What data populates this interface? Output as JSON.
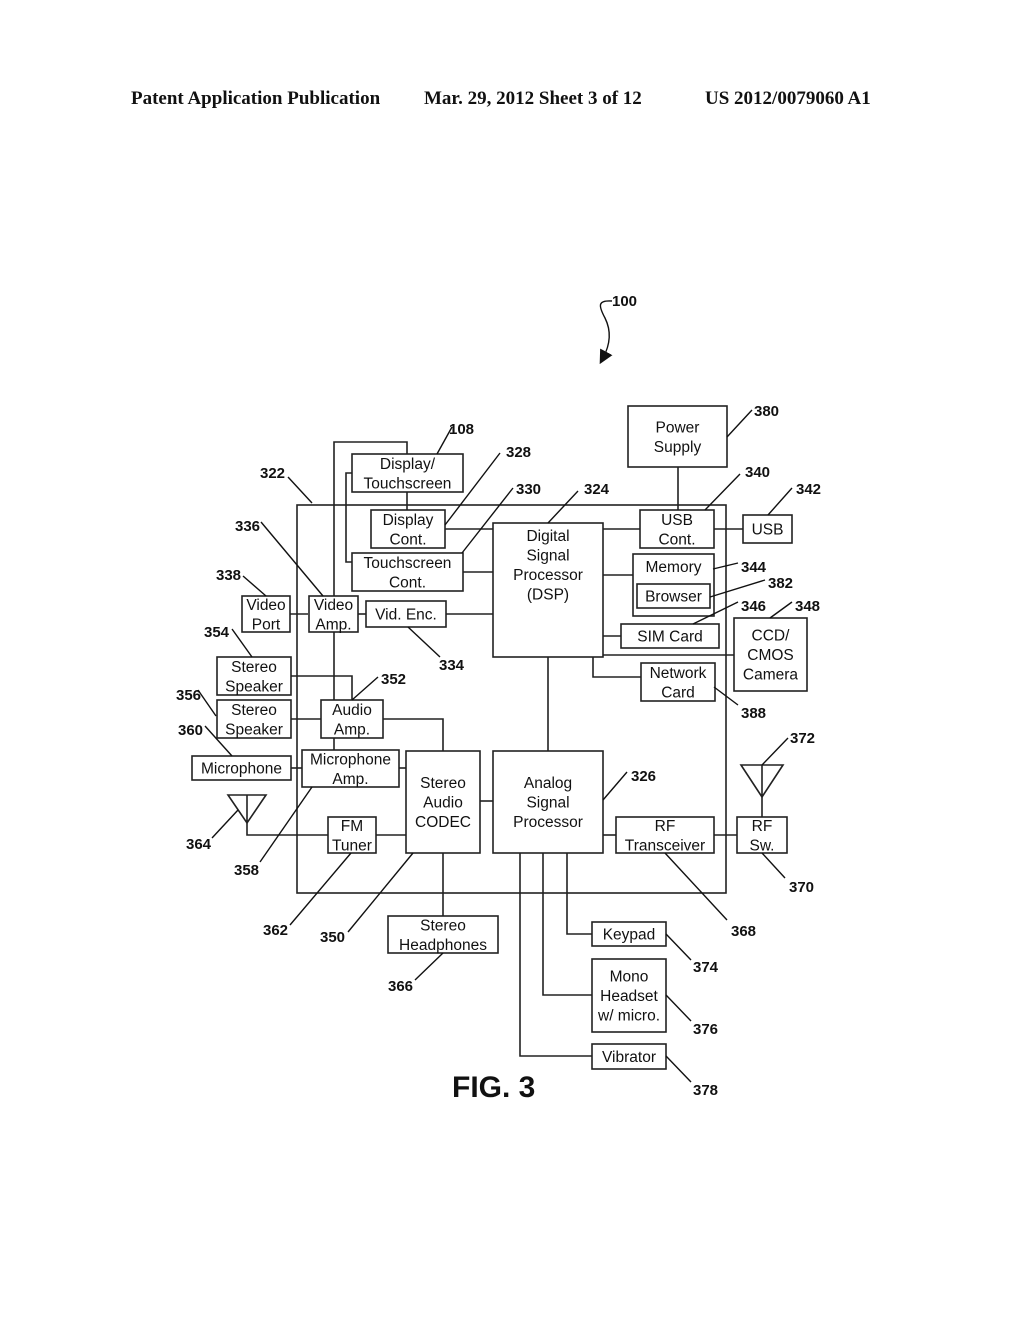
{
  "header": {
    "left": "Patent Application Publication",
    "middle": "Mar. 29, 2012  Sheet 3 of 12",
    "right": "US 2012/0079060 A1"
  },
  "figure": {
    "label": "FIG. 3",
    "device_ref": "100",
    "chip_ref": "322"
  },
  "components": [
    {
      "id": "power_supply",
      "lines": [
        "Power",
        "Supply"
      ],
      "ref": "380"
    },
    {
      "id": "display_touchscreen",
      "lines": [
        "Display/",
        "Touchscreen"
      ],
      "ref": "108"
    },
    {
      "id": "display_cont",
      "lines": [
        "Display",
        "Cont."
      ],
      "ref": "328"
    },
    {
      "id": "touchscreen_cont",
      "lines": [
        "Touchscreen",
        "Cont."
      ],
      "ref": "330"
    },
    {
      "id": "dsp",
      "lines": [
        "Digital",
        "Signal",
        "Processor",
        "(DSP)"
      ],
      "ref": "324"
    },
    {
      "id": "usb_cont",
      "lines": [
        "USB",
        "Cont."
      ],
      "ref": "340"
    },
    {
      "id": "usb",
      "lines": [
        "USB"
      ],
      "ref": "342"
    },
    {
      "id": "memory",
      "lines": [
        "Memory"
      ],
      "ref": "344"
    },
    {
      "id": "browser",
      "lines": [
        "Browser"
      ],
      "ref": "382"
    },
    {
      "id": "sim_card",
      "lines": [
        "SIM Card"
      ],
      "ref": "346"
    },
    {
      "id": "camera",
      "lines": [
        "CCD/",
        "CMOS",
        "Camera"
      ],
      "ref": "348"
    },
    {
      "id": "network_card",
      "lines": [
        "Network",
        "Card"
      ],
      "ref": "388"
    },
    {
      "id": "video_port",
      "lines": [
        "Video",
        "Port"
      ],
      "ref": "338"
    },
    {
      "id": "video_amp",
      "lines": [
        "Video",
        "Amp."
      ],
      "ref": "336"
    },
    {
      "id": "vid_enc",
      "lines": [
        "Vid. Enc."
      ],
      "ref": "334"
    },
    {
      "id": "stereo_speaker_1",
      "lines": [
        "Stereo",
        "Speaker"
      ],
      "ref": "354"
    },
    {
      "id": "stereo_speaker_2",
      "lines": [
        "Stereo",
        "Speaker"
      ],
      "ref": "356"
    },
    {
      "id": "audio_amp",
      "lines": [
        "Audio",
        "Amp."
      ],
      "ref": "352"
    },
    {
      "id": "microphone",
      "lines": [
        "Microphone"
      ],
      "ref": "360"
    },
    {
      "id": "microphone_amp",
      "lines": [
        "Microphone",
        "Amp."
      ],
      "ref": "358"
    },
    {
      "id": "stereo_audio_codec",
      "lines": [
        "Stereo",
        "Audio",
        "CODEC"
      ],
      "ref": "350"
    },
    {
      "id": "analog_signal_processor",
      "lines": [
        "Analog",
        "Signal",
        "Processor"
      ],
      "ref": "326"
    },
    {
      "id": "fm_tuner",
      "lines": [
        "FM",
        "Tuner"
      ],
      "ref": "362"
    },
    {
      "id": "rf_transceiver",
      "lines": [
        "RF",
        "Transceiver"
      ],
      "ref": "368"
    },
    {
      "id": "rf_switch",
      "lines": [
        "RF",
        "Sw."
      ],
      "ref": "370"
    },
    {
      "id": "stereo_headphones",
      "lines": [
        "Stereo",
        "Headphones"
      ],
      "ref": "366"
    },
    {
      "id": "keypad",
      "lines": [
        "Keypad"
      ],
      "ref": "374"
    },
    {
      "id": "mono_headset",
      "lines": [
        "Mono",
        "Headset",
        "w/ micro."
      ],
      "ref": "376"
    },
    {
      "id": "vibrator",
      "lines": [
        "Vibrator"
      ],
      "ref": "378"
    }
  ],
  "antennas": [
    {
      "id": "fm_antenna",
      "ref": "364"
    },
    {
      "id": "rf_antenna",
      "ref": "372"
    }
  ]
}
